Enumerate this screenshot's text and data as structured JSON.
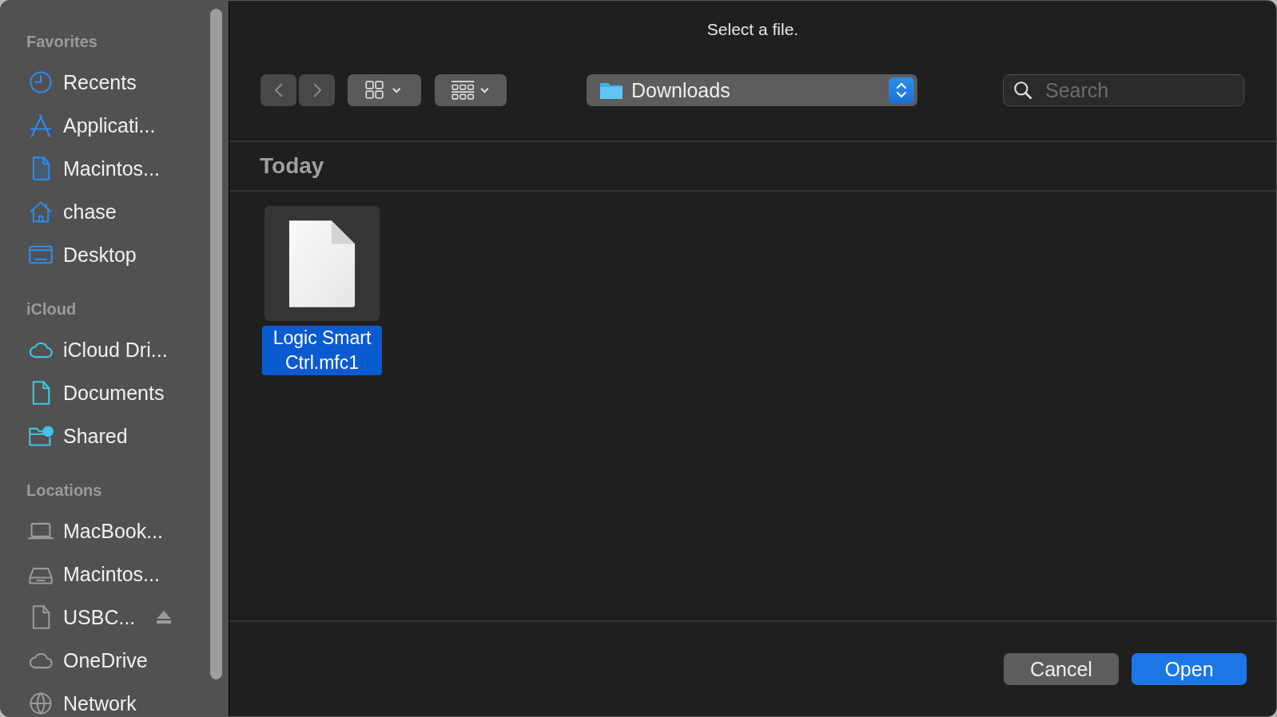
{
  "window": {
    "title": "Select a file."
  },
  "sidebar": {
    "sections": [
      {
        "heading": "Favorites",
        "items": [
          {
            "label": "Recents",
            "selected": false
          },
          {
            "label": "Applicati...",
            "selected": false
          },
          {
            "label": "Macintos...",
            "selected": false
          },
          {
            "label": "chase",
            "selected": false
          },
          {
            "label": "Desktop",
            "selected": false
          }
        ]
      },
      {
        "heading": "iCloud",
        "items": [
          {
            "label": "iCloud Dri...",
            "selected": false
          },
          {
            "label": "Documents",
            "selected": false
          },
          {
            "label": "Shared",
            "selected": false
          }
        ]
      },
      {
        "heading": "Locations",
        "items": [
          {
            "label": "MacBook...",
            "selected": false
          },
          {
            "label": "Macintos...",
            "selected": false
          },
          {
            "label": "USBC...",
            "selected": false,
            "ejectable": true
          },
          {
            "label": "OneDrive",
            "selected": false
          },
          {
            "label": "Network",
            "selected": false
          }
        ]
      }
    ]
  },
  "toolbar": {
    "back_disabled": true,
    "forward_disabled": true,
    "location": "Downloads",
    "search": {
      "placeholder": "Search"
    }
  },
  "groups": [
    {
      "heading": "Today",
      "files": [
        {
          "name": "Logic Smart Ctrl.mfc1",
          "selected": true
        }
      ]
    }
  ],
  "buttons": [
    {
      "label": "Cancel",
      "kind": "secondary"
    },
    {
      "label": "Open",
      "kind": "primary"
    }
  ]
}
